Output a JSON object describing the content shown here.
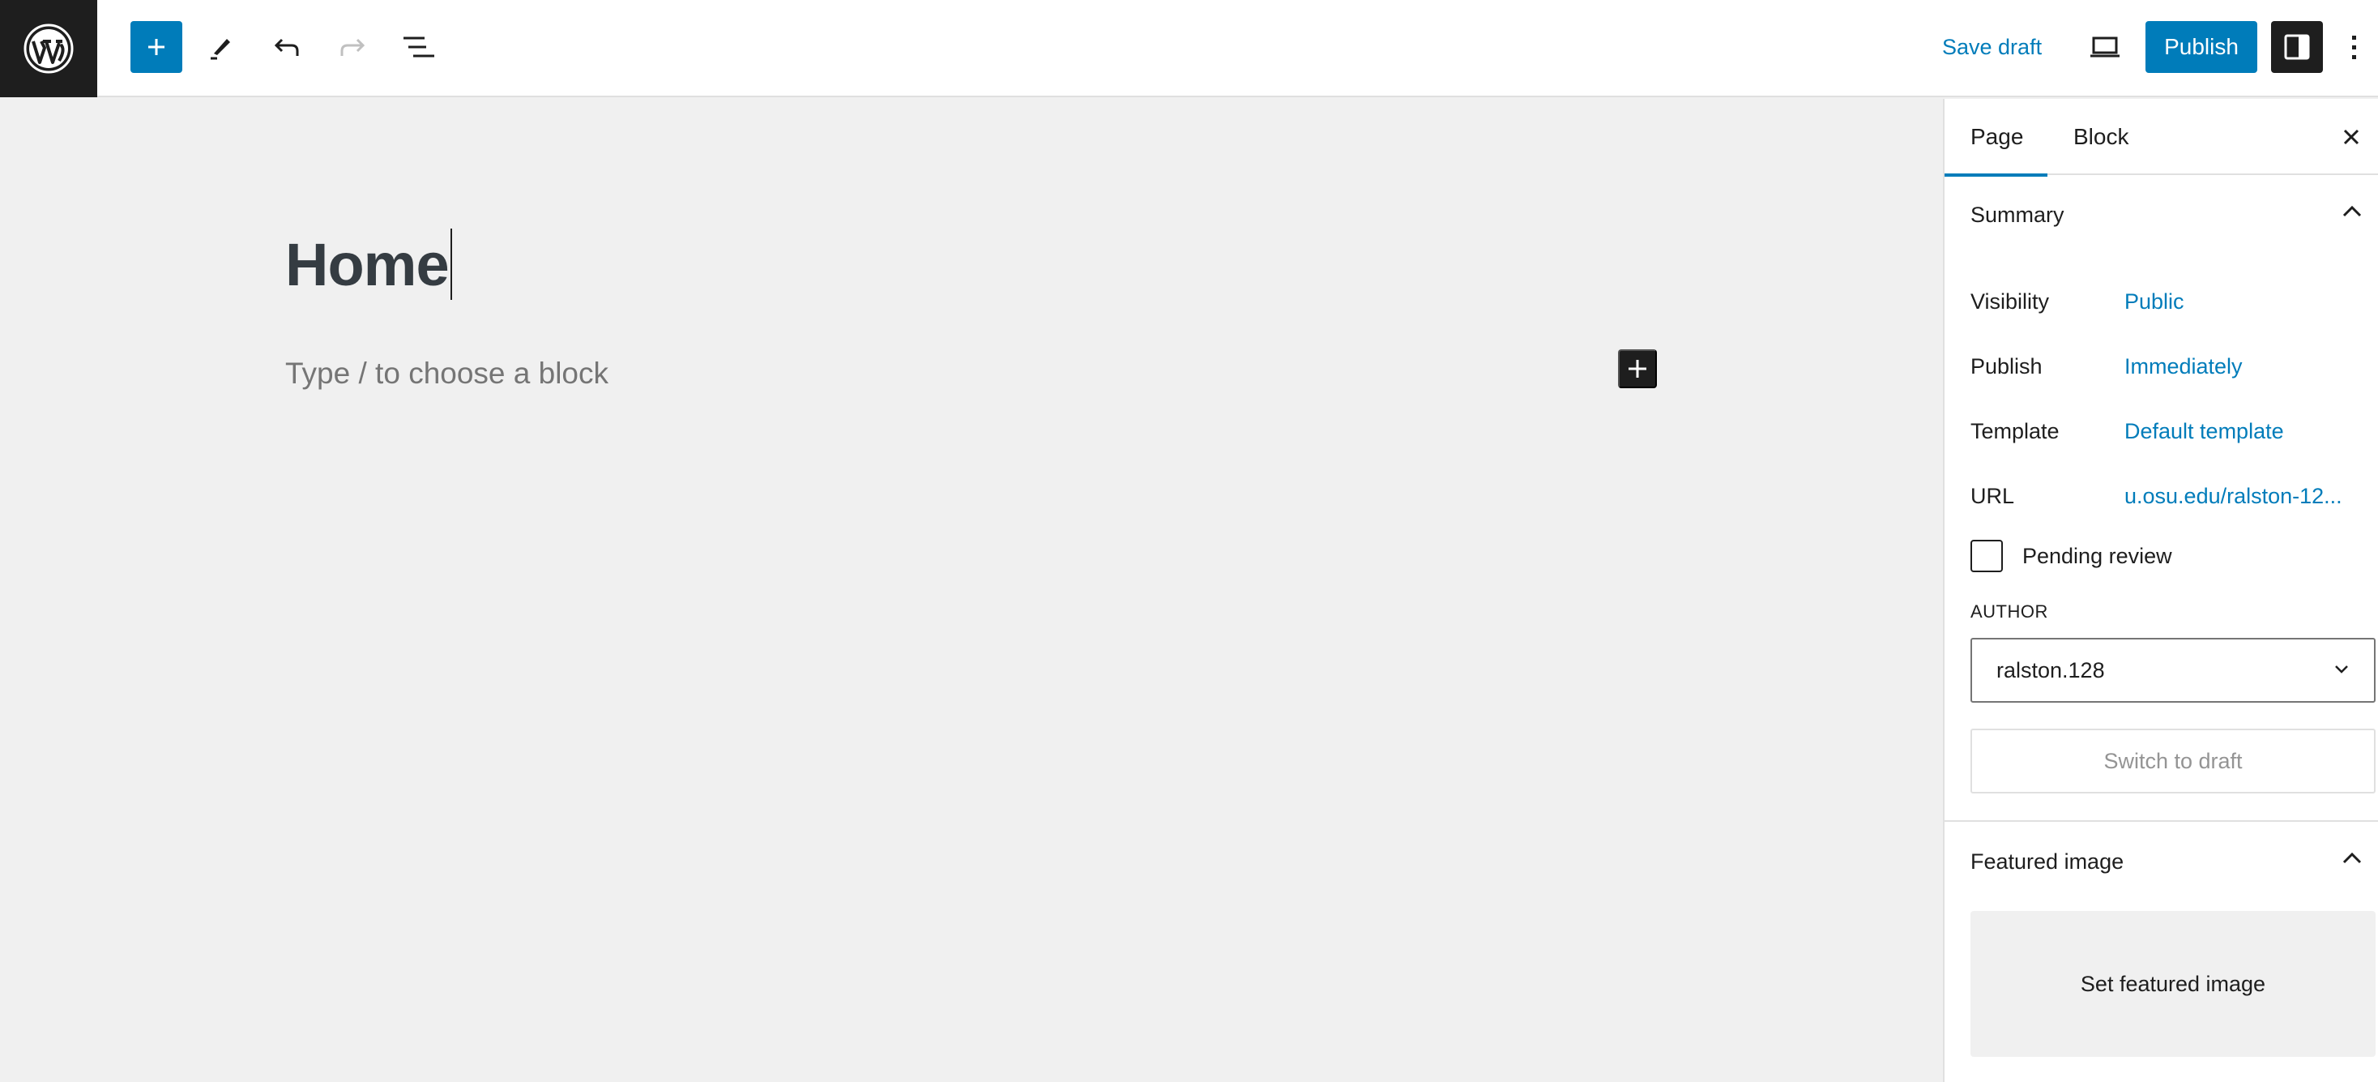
{
  "topbar": {
    "logo": "wordpress-logo",
    "inserter_icon": "plus-icon",
    "tools_icon": "pencil-icon",
    "undo_icon": "undo-icon",
    "redo_icon": "redo-icon",
    "listview_icon": "list-view-icon",
    "save_draft_label": "Save draft",
    "preview_icon": "laptop-icon",
    "publish_label": "Publish",
    "settings_icon": "sidebar-toggle-icon",
    "options_icon": "more-vertical-icon"
  },
  "editor": {
    "title": "Home",
    "block_placeholder": "Type / to choose a block",
    "block_add_icon": "plus-icon"
  },
  "sidebar": {
    "tabs": [
      {
        "label": "Page",
        "active": true
      },
      {
        "label": "Block",
        "active": false
      }
    ],
    "close_icon": "close-icon",
    "summary": {
      "title": "Summary",
      "expanded": true,
      "rows": [
        {
          "label": "Visibility",
          "value": "Public"
        },
        {
          "label": "Publish",
          "value": "Immediately"
        },
        {
          "label": "Template",
          "value": "Default template"
        },
        {
          "label": "URL",
          "value": "u.osu.edu/ralston-12..."
        }
      ],
      "pending_review": {
        "label": "Pending review",
        "checked": false
      },
      "author_label": "AUTHOR",
      "author_value": "ralston.128",
      "switch_to_draft_label": "Switch to draft"
    },
    "featured_image": {
      "title": "Featured image",
      "expanded": true,
      "button_label": "Set featured image"
    }
  },
  "colors": {
    "accent": "#007cba",
    "dark": "#1e1e1e",
    "canvas_bg": "#f0f0f0",
    "title_text": "#353c42",
    "placeholder_text": "#757575",
    "disabled_text": "#949494"
  }
}
